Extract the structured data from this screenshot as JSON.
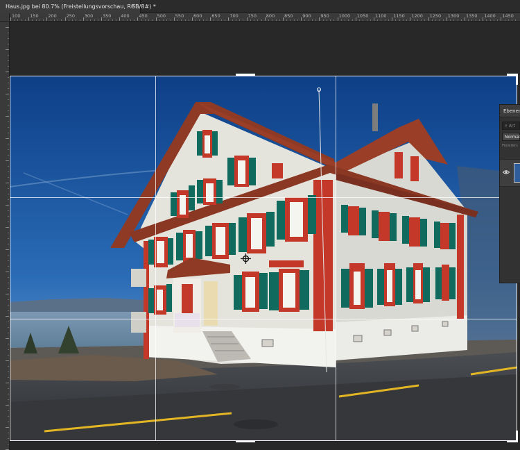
{
  "document_tab": {
    "title": "Haus.jpg bei 80.7% (Freistellungsvorschau, RGB/8#) *",
    "close_glyph": "×"
  },
  "ruler": {
    "unit": "px",
    "horizontal_labels": [
      "100",
      "150",
      "200",
      "250",
      "300",
      "350",
      "400",
      "450",
      "500",
      "550",
      "600",
      "650",
      "700",
      "750",
      "800",
      "850",
      "900",
      "950",
      "1000",
      "1050",
      "1100",
      "1150",
      "1200",
      "1250",
      "1300",
      "1350",
      "1400",
      "1450"
    ],
    "vertical_labels": [
      "0",
      "50",
      "100",
      "150",
      "200",
      "250",
      "300",
      "350",
      "400",
      "450",
      "500",
      "550",
      "600",
      "650",
      "700",
      "750",
      "800",
      "850",
      "900",
      "950"
    ]
  },
  "crop": {
    "overlay": "rule-of-thirds",
    "frame_color": "#ffffff"
  },
  "layers_panel": {
    "title": "Ebenen",
    "search_placeholder": "Art",
    "search_icon": "search-icon",
    "blend_mode": "Normal",
    "fix_label": "Fixieren:",
    "visibility_icon": "eye-icon"
  },
  "colors": {
    "app_background": "#262626",
    "panel_background": "#323232",
    "ruler_background": "#3a3a3a"
  }
}
